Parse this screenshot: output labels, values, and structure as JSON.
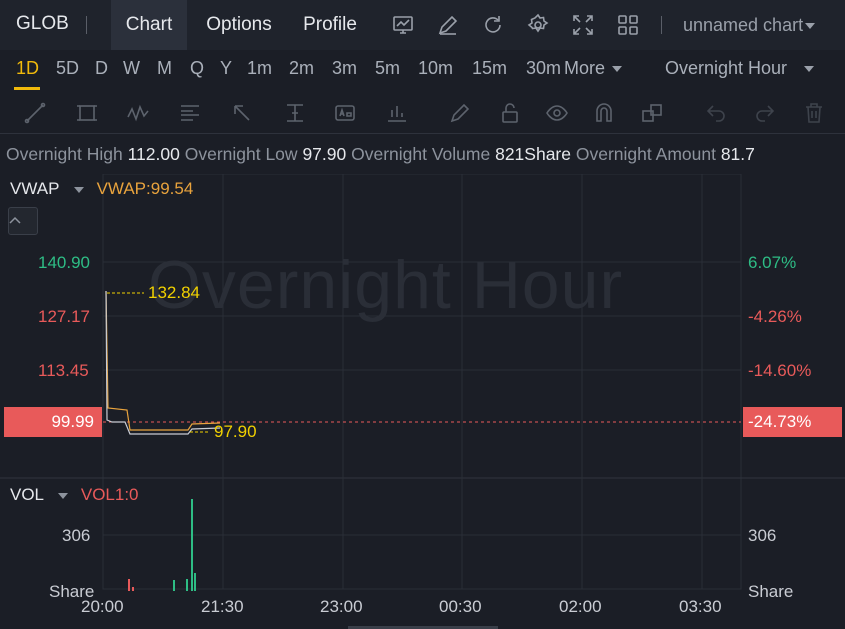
{
  "header": {
    "ticker": "GLOB",
    "tabs": [
      {
        "label": "Chart",
        "active": true
      },
      {
        "label": "Options",
        "active": false
      },
      {
        "label": "Profile",
        "active": false
      }
    ],
    "toolbar_icons": [
      "indicator-icon",
      "draw-icon",
      "refresh-icon",
      "settings-icon",
      "fullscreen-icon",
      "layout-icon"
    ],
    "chart_name": "unnamed chart"
  },
  "intervals": {
    "items": [
      "1D",
      "5D",
      "D",
      "W",
      "M",
      "Q",
      "Y",
      "1m",
      "2m",
      "3m",
      "5m",
      "10m",
      "15m",
      "30m",
      "More"
    ],
    "active": "1D",
    "session": "Overnight Hour"
  },
  "drawing_tools": [
    "trendline-icon",
    "rectangle-icon",
    "pattern-icon",
    "fibonacci-icon",
    "arrow-icon",
    "price-range-icon",
    "text-icon",
    "bar-pattern-icon",
    "pencil-icon",
    "lock-icon",
    "eye-icon",
    "magnet-icon",
    "layers-icon",
    "undo-icon",
    "redo-icon",
    "trash-icon"
  ],
  "info": {
    "high_label": "Overnight High",
    "high": "112.00",
    "low_label": "Overnight Low",
    "low": "97.90",
    "volume_label": "Overnight Volume",
    "volume": "821",
    "volume_unit": "Share",
    "amount_label": "Overnight Amount",
    "amount": "81.7"
  },
  "price_panel": {
    "indicator": "VWAP",
    "indicator_value": "VWAP:99.54",
    "watermark": "Overnight Hour",
    "left_ticks": [
      "140.90",
      "127.17",
      "113.45"
    ],
    "right_ticks": [
      "6.07%",
      "-4.26%",
      "-14.60%"
    ],
    "current_price": "99.99",
    "current_pct": "-24.73%",
    "high_marker": "132.84",
    "low_marker": "97.90"
  },
  "volume_panel": {
    "indicator": "VOL",
    "indicator_value": "VOL1:0",
    "left_tick": "306",
    "right_tick": "306",
    "unit": "Share"
  },
  "time_axis": [
    "20:00",
    "21:30",
    "23:00",
    "00:30",
    "02:00",
    "03:30"
  ],
  "colors": {
    "up": "#2ebd85",
    "down": "#e85a5a",
    "accent": "#f0b90b",
    "vwap": "#e8a33d",
    "grid": "#2a2e37"
  }
}
